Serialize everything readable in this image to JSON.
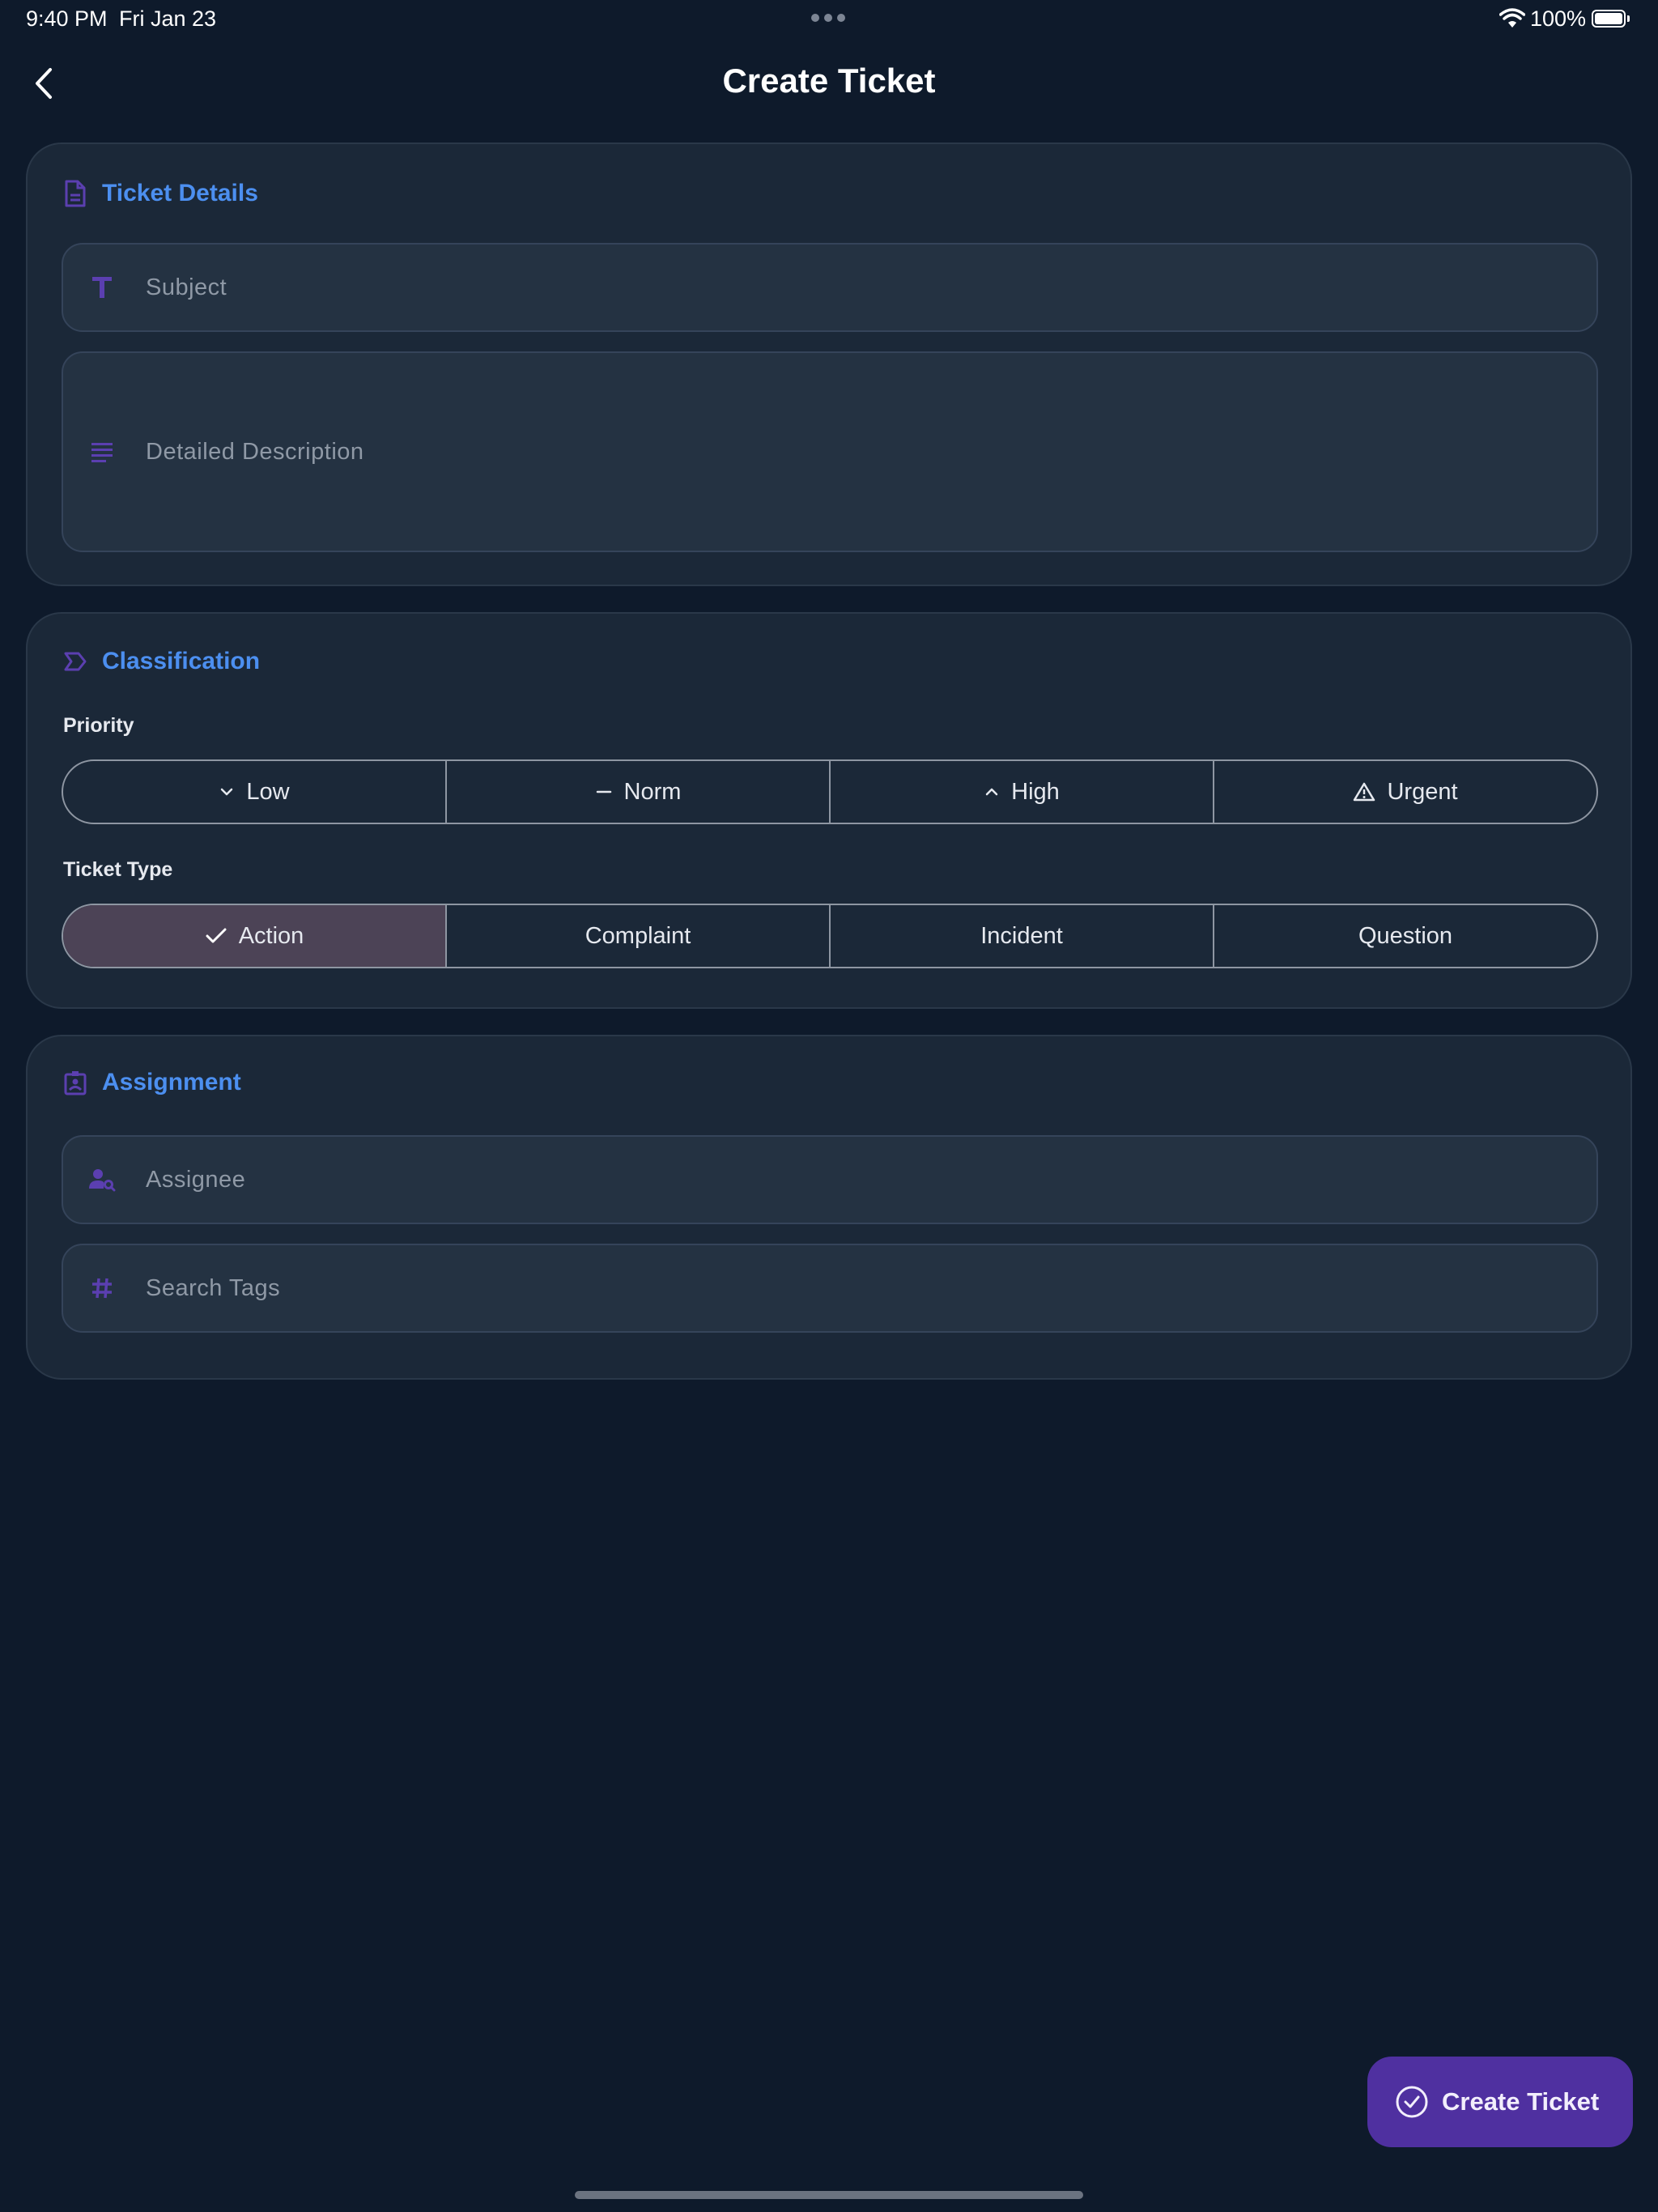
{
  "status_bar": {
    "time": "9:40 PM",
    "date": "Fri Jan 23",
    "battery": "100%"
  },
  "header": {
    "title": "Create Ticket"
  },
  "ticket_details": {
    "title": "Ticket Details",
    "subject_placeholder": "Subject",
    "description_placeholder": "Detailed Description"
  },
  "classification": {
    "title": "Classification",
    "priority_label": "Priority",
    "priority_options": [
      "Low",
      "Norm",
      "High",
      "Urgent"
    ],
    "ticket_type_label": "Ticket Type",
    "ticket_type_options": [
      "Action",
      "Complaint",
      "Incident",
      "Question"
    ],
    "ticket_type_selected": "Action"
  },
  "assignment": {
    "title": "Assignment",
    "assignee_placeholder": "Assignee",
    "tags_placeholder": "Search Tags"
  },
  "fab": {
    "label": "Create Ticket"
  },
  "colors": {
    "background": "#0e1a2b",
    "card": "#1b2838",
    "accent_blue": "#4c8ff0",
    "accent_purple": "#5b3fb0",
    "fab": "#4f30a0",
    "selected_segment": "#4c4356"
  },
  "icons": {
    "ticket_details": "document-icon",
    "classification": "label-icon",
    "assignment": "badge-icon",
    "subject": "text-format-icon",
    "description": "notes-icon",
    "assignee": "person-search-icon",
    "tags": "hashtag-icon"
  }
}
